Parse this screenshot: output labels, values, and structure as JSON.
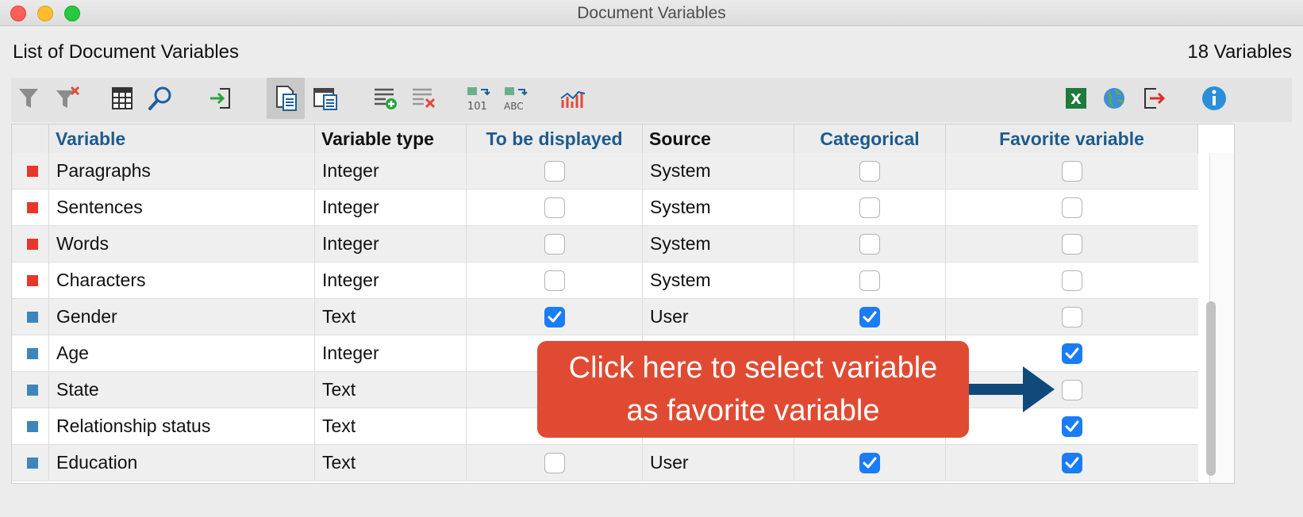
{
  "window": {
    "title": "Document Variables"
  },
  "header": {
    "list_label": "List of Document Variables",
    "count_label": "18 Variables"
  },
  "toolbar": {
    "icons": [
      "filter-icon",
      "clear-filter-icon",
      "columns-icon",
      "search-icon",
      "import-icon",
      "doc-variables-icon",
      "code-variables-icon",
      "new-variable-icon",
      "delete-variable-icon",
      "convert-integer-icon",
      "convert-text-icon",
      "statistics-chart-icon",
      "excel-export-icon",
      "web-export-icon",
      "exit-icon",
      "info-icon"
    ]
  },
  "table": {
    "columns": [
      "",
      "Variable",
      "Variable type",
      "To be displayed",
      "Source",
      "Categorical",
      "Favorite variable"
    ],
    "rows": [
      {
        "variable": "Paragraphs",
        "type": "Integer",
        "display": false,
        "source": "System",
        "categorical": false,
        "favorite": false,
        "color": "#e8362b"
      },
      {
        "variable": "Sentences",
        "type": "Integer",
        "display": false,
        "source": "System",
        "categorical": false,
        "favorite": false,
        "color": "#e8362b"
      },
      {
        "variable": "Words",
        "type": "Integer",
        "display": false,
        "source": "System",
        "categorical": false,
        "favorite": false,
        "color": "#e8362b"
      },
      {
        "variable": "Characters",
        "type": "Integer",
        "display": false,
        "source": "System",
        "categorical": false,
        "favorite": false,
        "color": "#e8362b"
      },
      {
        "variable": "Gender",
        "type": "Text",
        "display": true,
        "source": "User",
        "categorical": true,
        "favorite": false,
        "color": "#3d86ba"
      },
      {
        "variable": "Age",
        "type": "Integer",
        "display": null,
        "source": "",
        "categorical": null,
        "favorite": true,
        "color": "#3d86ba"
      },
      {
        "variable": "State",
        "type": "Text",
        "display": null,
        "source": "",
        "categorical": null,
        "favorite": false,
        "color": "#3d86ba"
      },
      {
        "variable": "Relationship status",
        "type": "Text",
        "display": null,
        "source": "",
        "categorical": null,
        "favorite": true,
        "color": "#3d86ba"
      },
      {
        "variable": "Education",
        "type": "Text",
        "display": false,
        "source": "User",
        "categorical": true,
        "favorite": true,
        "color": "#3d86ba"
      }
    ]
  },
  "callout": {
    "line1": "Click here to select variable",
    "line2": "as favorite variable",
    "color": "#e04a32",
    "arrow_color": "#0f4a7a"
  }
}
